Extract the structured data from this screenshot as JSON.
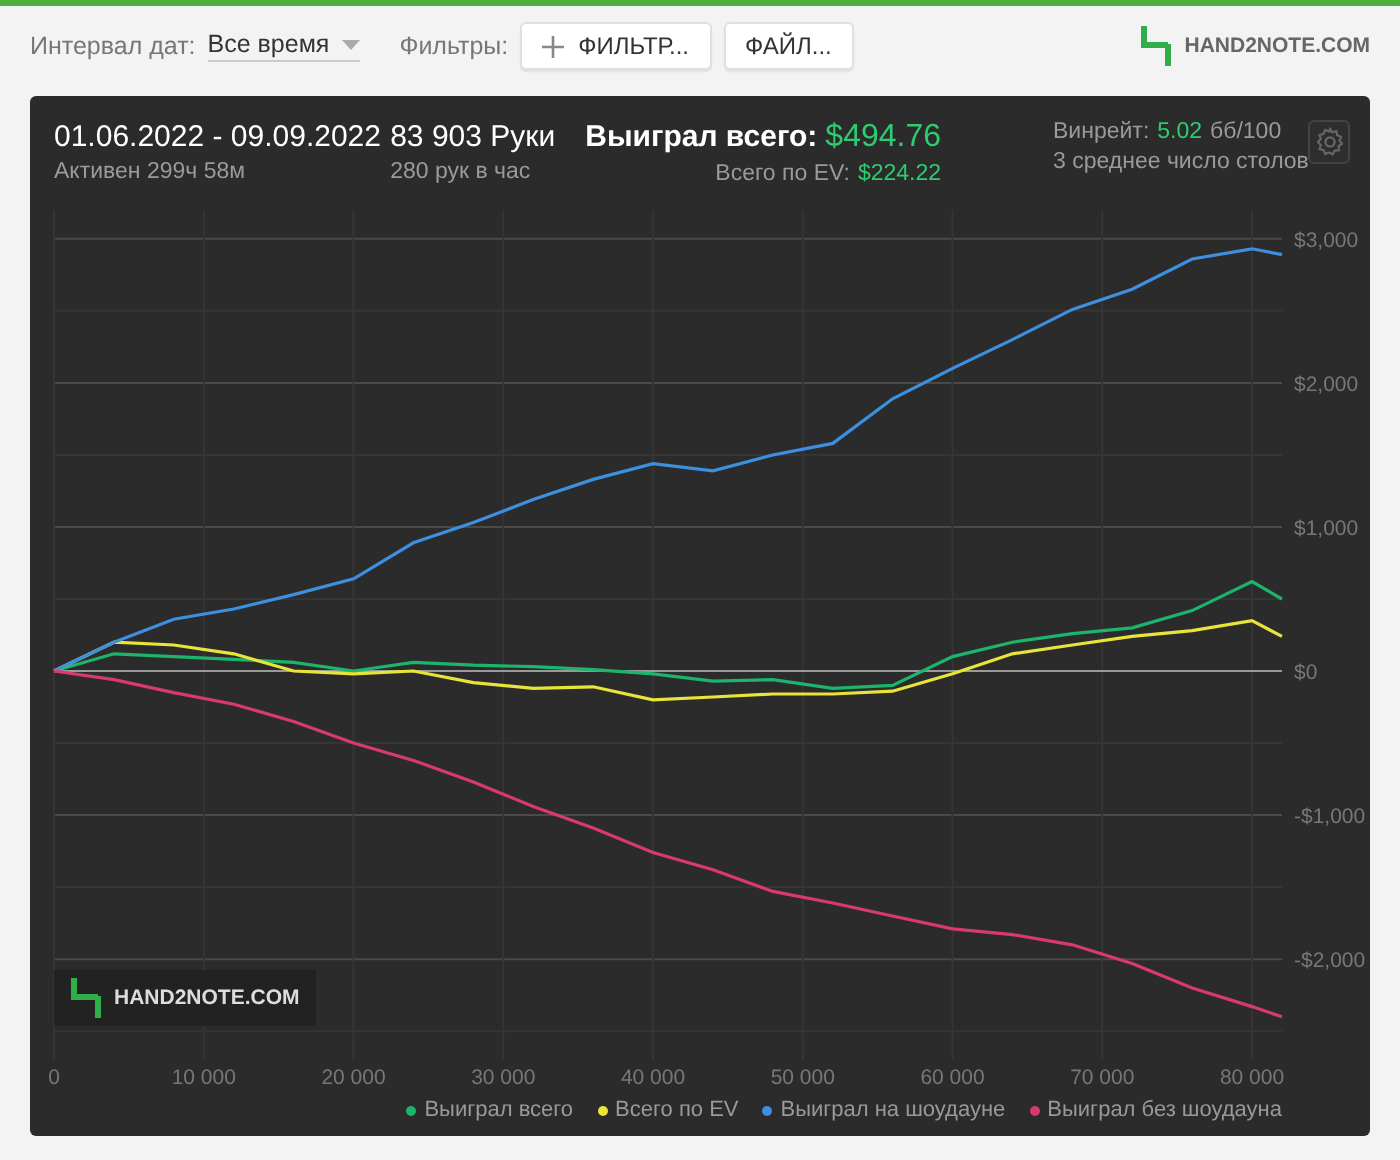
{
  "toolbar": {
    "date_label": "Интервал дат:",
    "date_value": "Все время",
    "filters_label": "Фильтры:",
    "filter_button": "ФИЛЬТР...",
    "file_button": "ФАЙЛ...",
    "logo": "HAND2NOTE.COM"
  },
  "summary": {
    "period": "01.06.2022 - 09.09.2022",
    "active": "Активен 299ч 58м",
    "hands": "83 903 Руки",
    "hands_rate": "280 рук в час",
    "won_label": "Выиграл всего:",
    "won_value": "$494.76",
    "ev_label": "Всего по EV:",
    "ev_value": "$224.22",
    "winrate_label": "Винрейт:",
    "winrate_value": "5.02",
    "winrate_unit": "бб/100",
    "tables": "3 среднее число столов"
  },
  "chart": {
    "watermark": "HAND2NOTE.COM",
    "chart_data": {
      "type": "line",
      "grid": true,
      "x": [
        0,
        4000,
        8000,
        12000,
        16000,
        20000,
        24000,
        28000,
        32000,
        36000,
        40000,
        44000,
        48000,
        52000,
        56000,
        60000,
        64000,
        68000,
        72000,
        76000,
        80000,
        82000
      ],
      "series": [
        {
          "name": "Выиграл всего",
          "color": "#1db46b",
          "values": [
            0,
            120,
            100,
            80,
            60,
            0,
            60,
            40,
            30,
            10,
            -20,
            -70,
            -60,
            -120,
            -100,
            100,
            200,
            260,
            300,
            420,
            620,
            500
          ]
        },
        {
          "name": "Всего по EV",
          "color": "#e8e43a",
          "values": [
            0,
            200,
            180,
            120,
            0,
            -20,
            0,
            -80,
            -120,
            -110,
            -200,
            -180,
            -160,
            -160,
            -140,
            -20,
            120,
            180,
            240,
            280,
            350,
            240
          ]
        },
        {
          "name": "Выиграл на шоудауне",
          "color": "#3d8fe0",
          "values": [
            0,
            200,
            360,
            430,
            530,
            640,
            890,
            1030,
            1190,
            1330,
            1440,
            1390,
            1500,
            1580,
            1890,
            2100,
            2300,
            2510,
            2650,
            2860,
            2930,
            2890
          ]
        },
        {
          "name": "Выиграл без шоудауна",
          "color": "#d93a6e",
          "values": [
            0,
            -60,
            -150,
            -230,
            -350,
            -500,
            -620,
            -770,
            -940,
            -1090,
            -1260,
            -1380,
            -1530,
            -1610,
            -1700,
            -1790,
            -1830,
            -1900,
            -2030,
            -2200,
            -2330,
            -2400
          ]
        }
      ],
      "xlim": [
        0,
        82000
      ],
      "ylim": [
        -2700,
        3200
      ],
      "xticks": [
        {
          "value": 0,
          "label": "0"
        },
        {
          "value": 10000,
          "label": "10 000"
        },
        {
          "value": 20000,
          "label": "20 000"
        },
        {
          "value": 30000,
          "label": "30 000"
        },
        {
          "value": 40000,
          "label": "40 000"
        },
        {
          "value": 50000,
          "label": "50 000"
        },
        {
          "value": 60000,
          "label": "60 000"
        },
        {
          "value": 70000,
          "label": "70 000"
        },
        {
          "value": 80000,
          "label": "80 000"
        }
      ],
      "yticks": [
        {
          "value": 3000,
          "label": "$3,000"
        },
        {
          "value": 2000,
          "label": "$2,000"
        },
        {
          "value": 1000,
          "label": "$1,000"
        },
        {
          "value": 0,
          "label": "$0"
        },
        {
          "value": -1000,
          "label": "-$1,000"
        },
        {
          "value": -2000,
          "label": "-$2,000"
        }
      ]
    }
  }
}
